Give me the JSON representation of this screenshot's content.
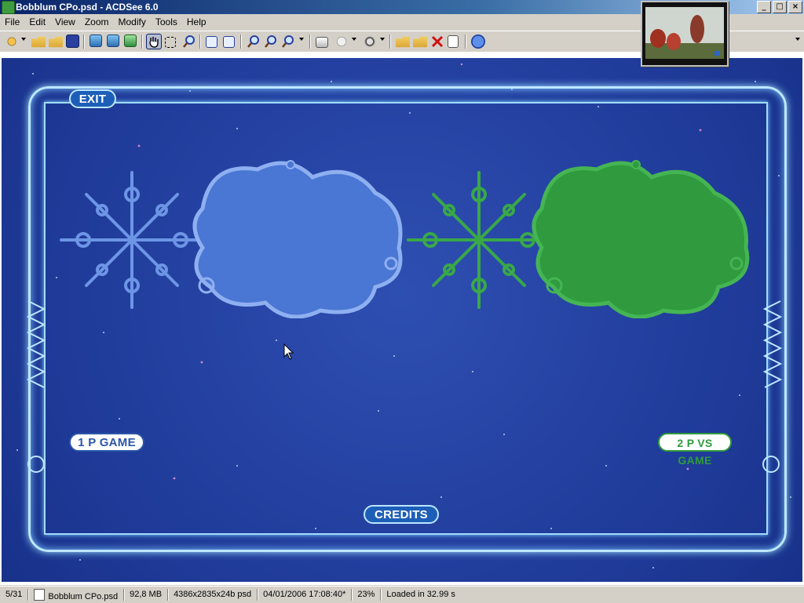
{
  "window": {
    "title": "Bobblum CPo.psd - ACDSee 6.0",
    "controls": [
      "_",
      "□",
      "×"
    ]
  },
  "menu": [
    "File",
    "Edit",
    "View",
    "Zoom",
    "Modify",
    "Tools",
    "Help"
  ],
  "toolbar_icons": [
    "acquire-icon",
    "open-folder-icon",
    "favorites-icon",
    "save-icon",
    "previous-image-icon",
    "next-image-icon",
    "slideshow-icon",
    "hand-tool-icon",
    "select-tool-icon",
    "magnifier-icon",
    "rotate-left-icon",
    "rotate-right-icon",
    "zoom-out-icon",
    "zoom-in-icon",
    "zoom-menu-icon",
    "print-icon",
    "send-icon",
    "set-wallpaper-icon",
    "export-icon",
    "move-to-icon",
    "delete-icon",
    "properties-icon",
    "help-icon"
  ],
  "game_screen": {
    "exit_label": "EXIT",
    "one_player_label": "1 P  GAME",
    "two_player_label": "2 P VS GAME",
    "credits_label": "CREDITS",
    "blue": "#4a76d4",
    "green": "#2f9a3e"
  },
  "statusbar": {
    "position": "5/31",
    "filename": "Bobblum CPo.psd",
    "filesize": "92,8 MB",
    "dimensions": "4386x2835x24b psd",
    "datetime": "04/01/2006 17:08:40*",
    "zoom": "23%",
    "loadtime": "Loaded in 32.99 s"
  }
}
